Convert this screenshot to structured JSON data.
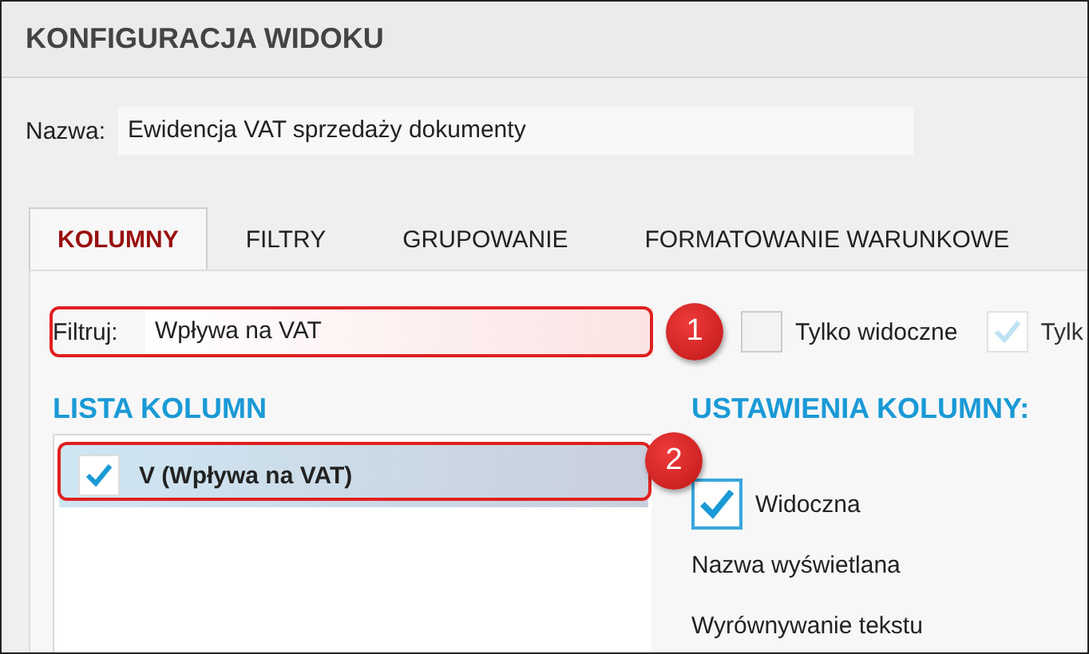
{
  "window": {
    "title": "KONFIGURACJA WIDOKU"
  },
  "name_field": {
    "label": "Nazwa:",
    "value": "Ewidencja VAT sprzedaży dokumenty"
  },
  "tabs": [
    {
      "label": "KOLUMNY",
      "selected": true
    },
    {
      "label": "FILTRY",
      "selected": false
    },
    {
      "label": "GRUPOWANIE",
      "selected": false
    },
    {
      "label": "FORMATOWANIE WARUNKOWE",
      "selected": false
    }
  ],
  "filter": {
    "label": "Filtruj:",
    "value": "Wpływa na VAT",
    "callout": "1"
  },
  "filter_options": [
    {
      "label": "Tylko widoczne",
      "checked": false,
      "disabled": false
    },
    {
      "label": "Tylk",
      "checked": true,
      "disabled": true
    }
  ],
  "column_list": {
    "heading": "LISTA KOLUMN",
    "items": [
      {
        "label": "V (Wpływa na VAT)",
        "checked": true,
        "selected": true,
        "callout": "2"
      }
    ]
  },
  "column_settings": {
    "heading": "USTAWIENIA KOLUMNY:",
    "visible": {
      "label": "Widoczna",
      "checked": true
    },
    "fields": [
      {
        "label": "Nazwa wyświetlana"
      },
      {
        "label": "Wyrównywanie tekstu"
      }
    ]
  }
}
